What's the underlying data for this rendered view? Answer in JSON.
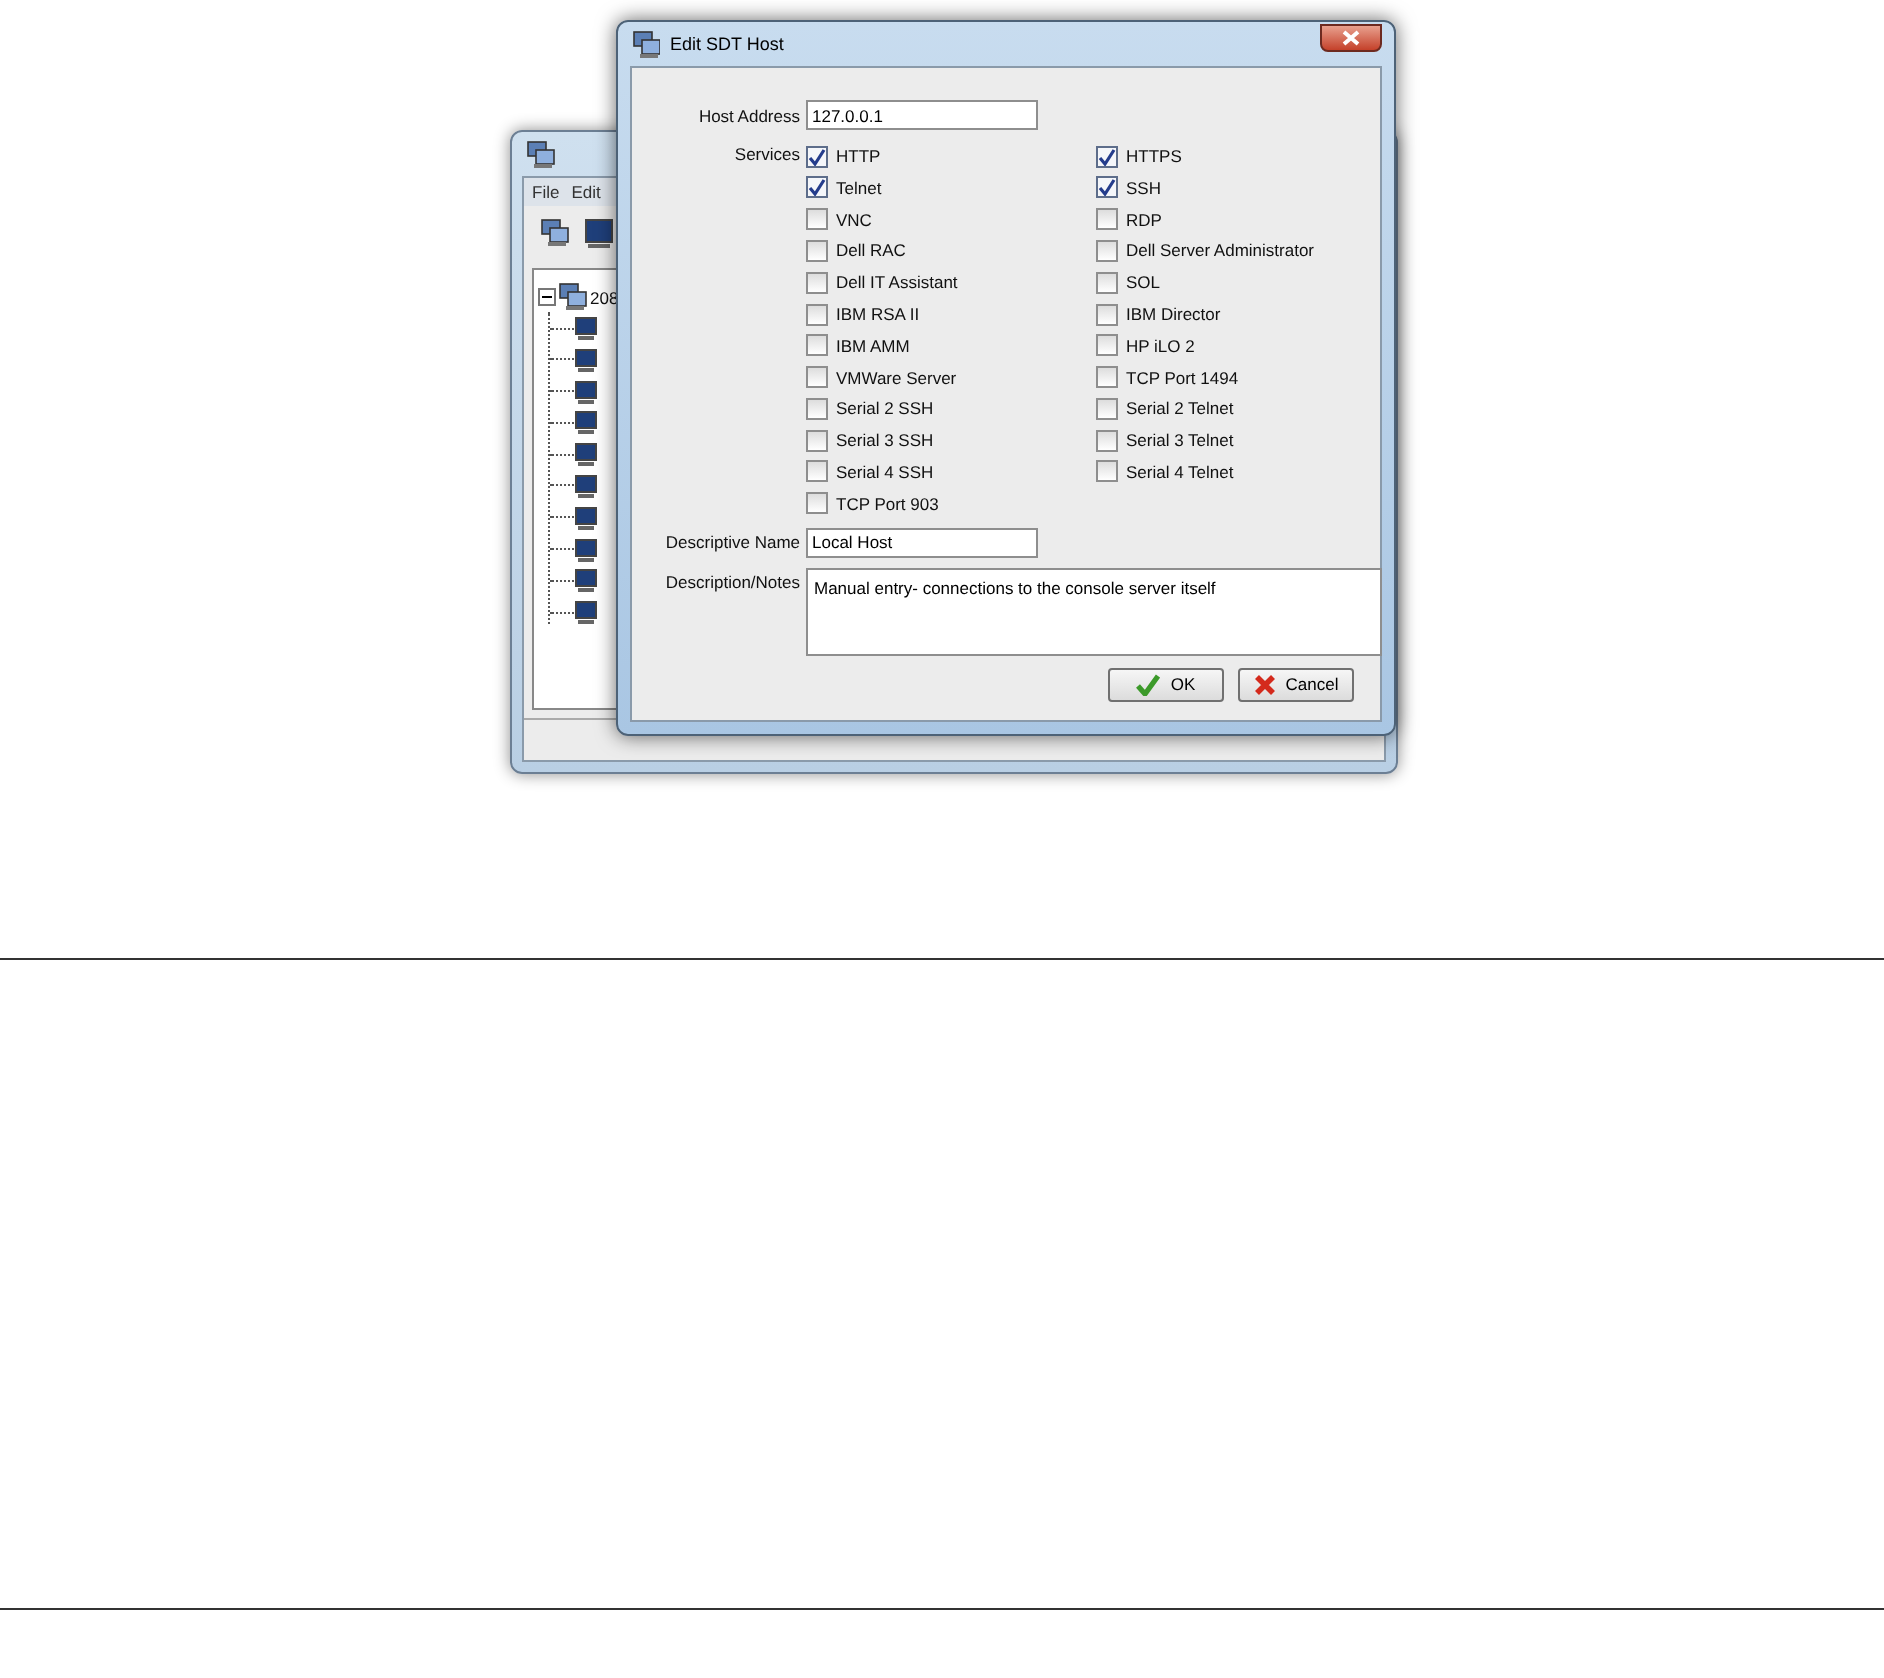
{
  "background_window": {
    "menu": [
      "File",
      "Edit"
    ],
    "toolbar": [
      {
        "kind": "hosts"
      },
      {
        "kind": "computer"
      }
    ],
    "tree": {
      "label": "208",
      "expanded": true,
      "children": [
        {
          "kind": "computer"
        },
        {
          "kind": "computer"
        },
        {
          "kind": "computer"
        },
        {
          "kind": "computer"
        },
        {
          "kind": "computer"
        },
        {
          "kind": "computer"
        },
        {
          "kind": "computer"
        },
        {
          "kind": "computer"
        },
        {
          "kind": "computer"
        },
        {
          "kind": "computer"
        }
      ]
    }
  },
  "dialog": {
    "title": "Edit SDT Host",
    "host_address": {
      "label": "Host Address",
      "value": "127.0.0.1"
    },
    "services_label": "Services",
    "services": [
      {
        "label": "HTTP",
        "checked": true
      },
      {
        "label": "HTTPS",
        "checked": true
      },
      {
        "label": "Telnet",
        "checked": true
      },
      {
        "label": "SSH",
        "checked": true
      },
      {
        "label": "VNC",
        "checked": false
      },
      {
        "label": "RDP",
        "checked": false
      },
      {
        "label": "Dell RAC",
        "checked": false
      },
      {
        "label": "Dell Server Administrator",
        "checked": false
      },
      {
        "label": "Dell IT Assistant",
        "checked": false
      },
      {
        "label": "SOL",
        "checked": false
      },
      {
        "label": "IBM RSA II",
        "checked": false
      },
      {
        "label": "IBM Director",
        "checked": false
      },
      {
        "label": "IBM AMM",
        "checked": false
      },
      {
        "label": "HP iLO 2",
        "checked": false
      },
      {
        "label": "VMWare Server",
        "checked": false
      },
      {
        "label": "TCP Port 1494",
        "checked": false
      },
      {
        "label": "Serial 2 SSH",
        "checked": false
      },
      {
        "label": "Serial 2 Telnet",
        "checked": false
      },
      {
        "label": "Serial 3 SSH",
        "checked": false
      },
      {
        "label": "Serial 3 Telnet",
        "checked": false
      },
      {
        "label": "Serial 4 SSH",
        "checked": false
      },
      {
        "label": "Serial 4 Telnet",
        "checked": false
      },
      {
        "label": "TCP Port 903",
        "checked": false
      }
    ],
    "descriptive_name": {
      "label": "Descriptive Name",
      "value": "Local Host"
    },
    "notes": {
      "label": "Description/Notes",
      "value": "Manual entry- connections to the console server itself"
    },
    "buttons": [
      {
        "label": "OK",
        "kind": "ok"
      },
      {
        "label": "Cancel",
        "kind": "cancel"
      }
    ]
  }
}
